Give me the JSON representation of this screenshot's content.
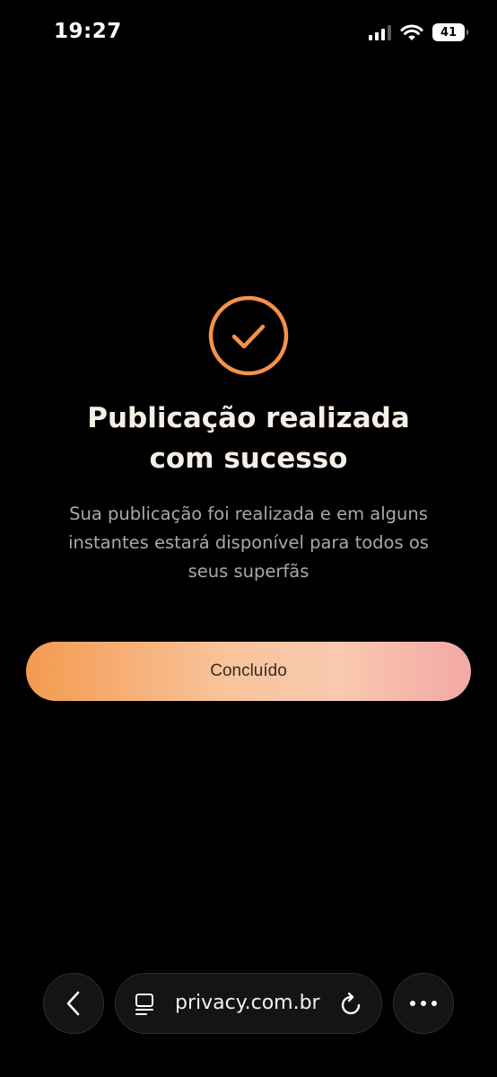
{
  "status_bar": {
    "time": "19:27",
    "battery_level": "41",
    "icons": [
      "signal-icon",
      "wifi-icon",
      "battery-icon"
    ]
  },
  "success": {
    "icon": "check-circle-icon",
    "title_line1": "Publicação realizada",
    "title_line2": "com sucesso",
    "description_line1": "Sua publicação foi realizada e em alguns",
    "description_line2": "instantes estará disponível para todos os",
    "description_line3": "seus superfãs",
    "button_label": "Concluído"
  },
  "browser": {
    "url": "privacy.com.br",
    "icons": [
      "back-icon",
      "page-icon",
      "reload-icon",
      "more-icon"
    ]
  },
  "colors": {
    "accent": "#f4924a",
    "background": "#000000",
    "title": "#f6efe6",
    "description": "#a9a9ad",
    "button_gradient_start": "#f49a50",
    "button_gradient_end": "#f3a8a6"
  }
}
